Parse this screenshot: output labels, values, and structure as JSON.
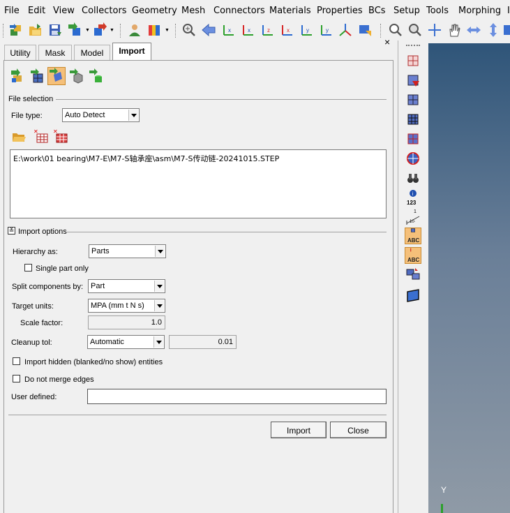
{
  "menu": [
    "File",
    "Edit",
    "View",
    "Collectors",
    "Geometry",
    "Mesh",
    "Connectors",
    "Materials",
    "Properties",
    "BCs",
    "Setup",
    "Tools",
    "Morphing",
    "I"
  ],
  "toolbar_icons": [
    "import-geometry-icon",
    "open-model-icon",
    "save-icon",
    "import-icon",
    "export-icon",
    "user-profile-icon",
    "color-palette-icon",
    "zoom-window-icon",
    "arrow-left-icon",
    "rotate-x-left-icon",
    "rotate-x-right-icon",
    "rotate-z-left-icon",
    "rotate-z-right-icon",
    "rotate-y-left-icon",
    "rotate-y-right-icon",
    "rotate-xyz-icon",
    "fit-view-icon",
    "zoom-in-icon",
    "zoom-out-icon",
    "pan-cross-icon",
    "hand-icon",
    "horizontal-arrows-icon",
    "vertical-arrows-icon"
  ],
  "tabs": [
    "Utility",
    "Mask",
    "Model",
    "Import"
  ],
  "active_tab": "Import",
  "close_glyph": "×",
  "file_selection": {
    "header": "File selection",
    "file_type_label": "File type:",
    "file_type_value": "Auto Detect",
    "path": "E:\\work\\01 bearing\\M7-E\\M7-S轴承座\\asm\\M7-S传动链-20241015.STEP"
  },
  "import_options": {
    "header": "Import options",
    "hierarchy_label": "Hierarchy as:",
    "hierarchy_value": "Parts",
    "single_part_label": "Single part only",
    "split_label": "Split components by:",
    "split_value": "Part",
    "target_units_label": "Target units:",
    "target_units_value": "MPA (mm t N s)",
    "scale_factor_label": "Scale factor:",
    "scale_factor_value": "1.0",
    "cleanup_label": "Cleanup tol:",
    "cleanup_value": "Automatic",
    "cleanup_tol_value": "0.01",
    "import_hidden_label": "Import hidden (blanked/no show) entities",
    "no_merge_label": "Do not merge edges",
    "user_defined_label": "User defined:",
    "user_defined_value": ""
  },
  "buttons": {
    "import": "Import",
    "close": "Close"
  },
  "right_toolbar": {
    "info_label": "123",
    "abc_label": "ABC",
    "scale_label_top": "1",
    "scale_label_bottom": "10·"
  },
  "viewport": {
    "axis_label": "Y"
  },
  "colors": {
    "viewport_top": "#2f5579",
    "viewport_bottom": "#8f9aa6",
    "active_tab_bg": "#ffffff"
  }
}
